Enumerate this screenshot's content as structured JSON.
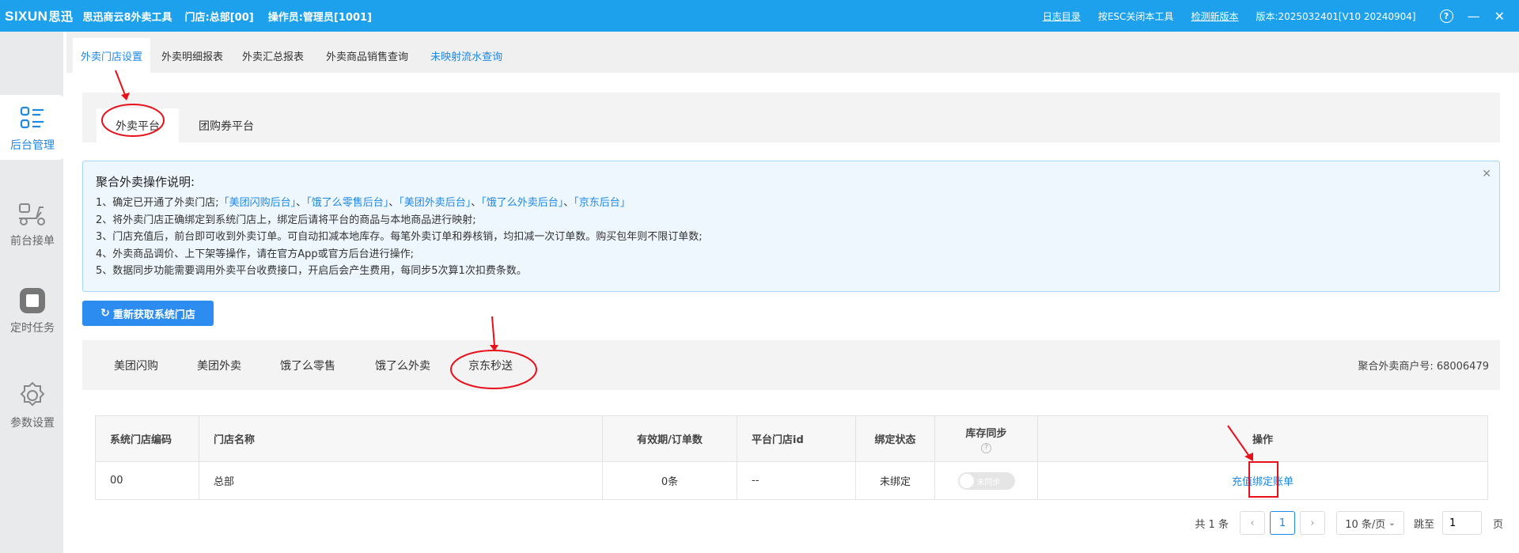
{
  "titlebar": {
    "logo": "SIXUN",
    "logo_cn": "思迅",
    "product": "思迅商云8外卖工具",
    "store": "门店:总部[00]",
    "operator": "操作员:管理员[1001]",
    "links": [
      "日志目录",
      "按ESC关闭本工具",
      "检测新版本"
    ],
    "version": "版本:2025032401[V10 20240904]",
    "help_glyph": "?",
    "minimize_glyph": "—",
    "close_glyph": "✕"
  },
  "sidebar": [
    {
      "label": "后台管理",
      "icon": "list-icon",
      "active": true
    },
    {
      "label": "前台接单",
      "icon": "scooter-icon",
      "active": false
    },
    {
      "label": "定时任务",
      "icon": "task-icon",
      "active": false
    },
    {
      "label": "参数设置",
      "icon": "gear-icon",
      "active": false
    }
  ],
  "nav_tabs": [
    "外卖门店设置",
    "外卖明细报表",
    "外卖汇总报表",
    "外卖商品销售查询",
    "未映射流水查询"
  ],
  "platform_tabs": [
    "外卖平台",
    "团购券平台"
  ],
  "notice": {
    "title": "聚合外卖操作说明:",
    "line1_prefix": "1、确定已开通了外卖门店;",
    "line1_links": [
      "「美团闪购后台」",
      "「饿了么零售后台」",
      "「美团外卖后台」",
      "「饿了么外卖后台」",
      "「京东后台」"
    ],
    "line1_sep": "、",
    "lines": [
      "2、将外卖门店正确绑定到系统门店上，绑定后请将平台的商品与本地商品进行映射;",
      "3、门店充值后，前台即可收到外卖订单。可自动扣减本地库存。每笔外卖订单和券核销，均扣减一次订单数。购买包年则不限订单数;",
      "4、外卖商品调价、上下架等操作，请在官方App或官方后台进行操作;",
      "5、数据同步功能需要调用外卖平台收费接口，开启后会产生费用，每同步5次算1次扣费条数。"
    ],
    "close_glyph": "✕"
  },
  "refresh_button": "重新获取系统门店",
  "sub_tabs": [
    "美团闪购",
    "美团外卖",
    "饿了么零售",
    "饿了么外卖",
    "京东秒送"
  ],
  "merchant": "聚合外卖商户号: 68006479",
  "table": {
    "headers": [
      "系统门店编码",
      "门店名称",
      "有效期/订单数",
      "平台门店id",
      "绑定状态",
      "库存同步",
      "操作"
    ],
    "help_glyph": "?",
    "row": {
      "code": "00",
      "name": "总部",
      "orders": "0条",
      "platform_id": "--",
      "status": "未绑定",
      "sync_toggle": "未同步",
      "actions": [
        "充值",
        "绑定",
        "账单"
      ]
    }
  },
  "pagination": {
    "total": "共 1 条",
    "prev": "‹",
    "current_page": "1",
    "next": "›",
    "page_size": "10 条/页",
    "jump_label": "跳至",
    "jump_value": "1",
    "page_unit": "页"
  },
  "colors": {
    "accent": "#1e88e5",
    "titlebar": "#1ea1ec",
    "danger": "#e02020",
    "annotation": "#e8101a"
  }
}
